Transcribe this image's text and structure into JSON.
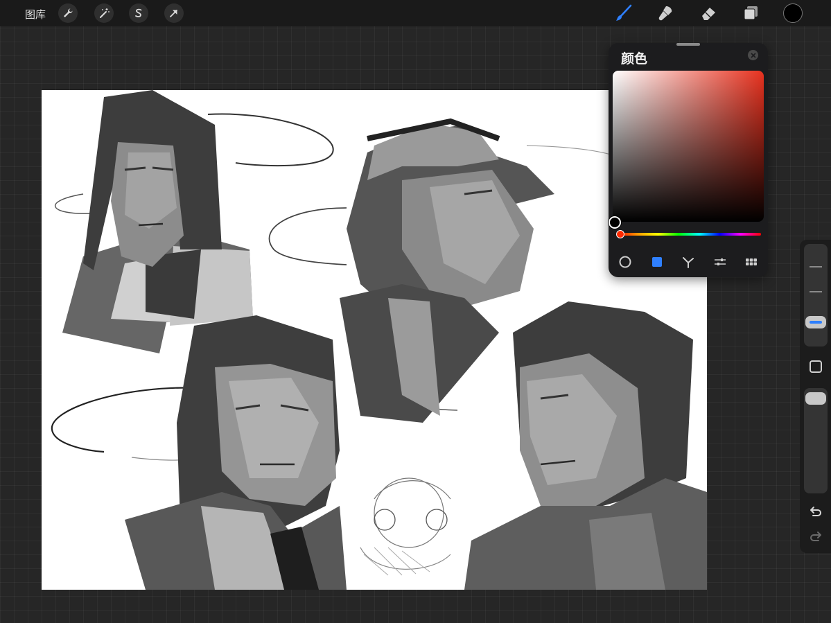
{
  "toolbar": {
    "gallery_label": "图库",
    "left_tools": [
      "wrench-icon",
      "magic-wand-icon",
      "selection-s-icon",
      "transform-arrow-icon"
    ],
    "right_tools": [
      "brush-icon",
      "smudge-icon",
      "eraser-icon",
      "layers-icon"
    ],
    "active_tool": "brush-icon",
    "active_tool_color": "#2f80ff",
    "current_color": "#000000"
  },
  "color_panel": {
    "title": "颜色",
    "hue_color": "#e8321f",
    "selected_color": "#000000",
    "modes": [
      "disc-icon",
      "classic-icon",
      "harmony-icon",
      "value-icon",
      "palettes-icon"
    ],
    "active_mode": "classic-icon",
    "accent": "#2f80ff"
  },
  "sidebar": {
    "size_slider_level": 0.78,
    "opacity_slider_level": 1.0,
    "controls": [
      "modify-square-icon",
      "undo-icon",
      "redo-icon"
    ]
  }
}
